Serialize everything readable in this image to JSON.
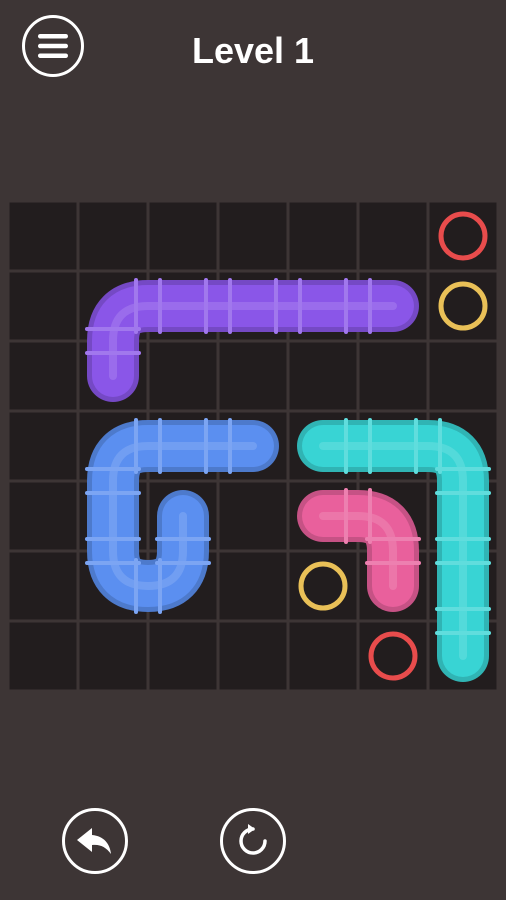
{
  "header": {
    "title": "Level 1",
    "menu_icon": "hamburger-menu-icon"
  },
  "board": {
    "rows": 7,
    "cols": 7,
    "cell_color": "#221d1e",
    "background": "#3d3535"
  },
  "pipes": [
    {
      "name": "pipe-purple",
      "color": "#8a56e8",
      "path": [
        [
          5,
          1
        ],
        [
          4,
          1
        ],
        [
          3,
          1
        ],
        [
          2,
          1
        ],
        [
          1,
          1
        ],
        [
          1,
          2
        ]
      ]
    },
    {
      "name": "pipe-blue",
      "color": "#5b8ff0",
      "path": [
        [
          3,
          3
        ],
        [
          2,
          3
        ],
        [
          1,
          3
        ],
        [
          1,
          4
        ],
        [
          1,
          5
        ],
        [
          2,
          5
        ],
        [
          2,
          4
        ]
      ]
    },
    {
      "name": "pipe-cyan",
      "color": "#38d4d4",
      "path": [
        [
          4,
          3
        ],
        [
          5,
          3
        ],
        [
          6,
          3
        ],
        [
          6,
          4
        ],
        [
          6,
          5
        ],
        [
          6,
          6
        ]
      ]
    },
    {
      "name": "pipe-pink",
      "color": "#e9609c",
      "path": [
        [
          4,
          4
        ],
        [
          5,
          4
        ],
        [
          5,
          5
        ]
      ]
    }
  ],
  "endpoints": [
    {
      "name": "endpoint-red-top",
      "color": "#e84c4c",
      "cell": [
        6,
        0
      ]
    },
    {
      "name": "endpoint-yellow-top",
      "color": "#e9c057",
      "cell": [
        6,
        1
      ]
    },
    {
      "name": "endpoint-yellow-bottom",
      "color": "#e9c057",
      "cell": [
        4,
        5
      ]
    },
    {
      "name": "endpoint-red-bottom",
      "color": "#e84c4c",
      "cell": [
        5,
        6
      ]
    }
  ],
  "footer": {
    "undo_icon": "undo-arrow-icon",
    "restart_icon": "restart-icon"
  }
}
